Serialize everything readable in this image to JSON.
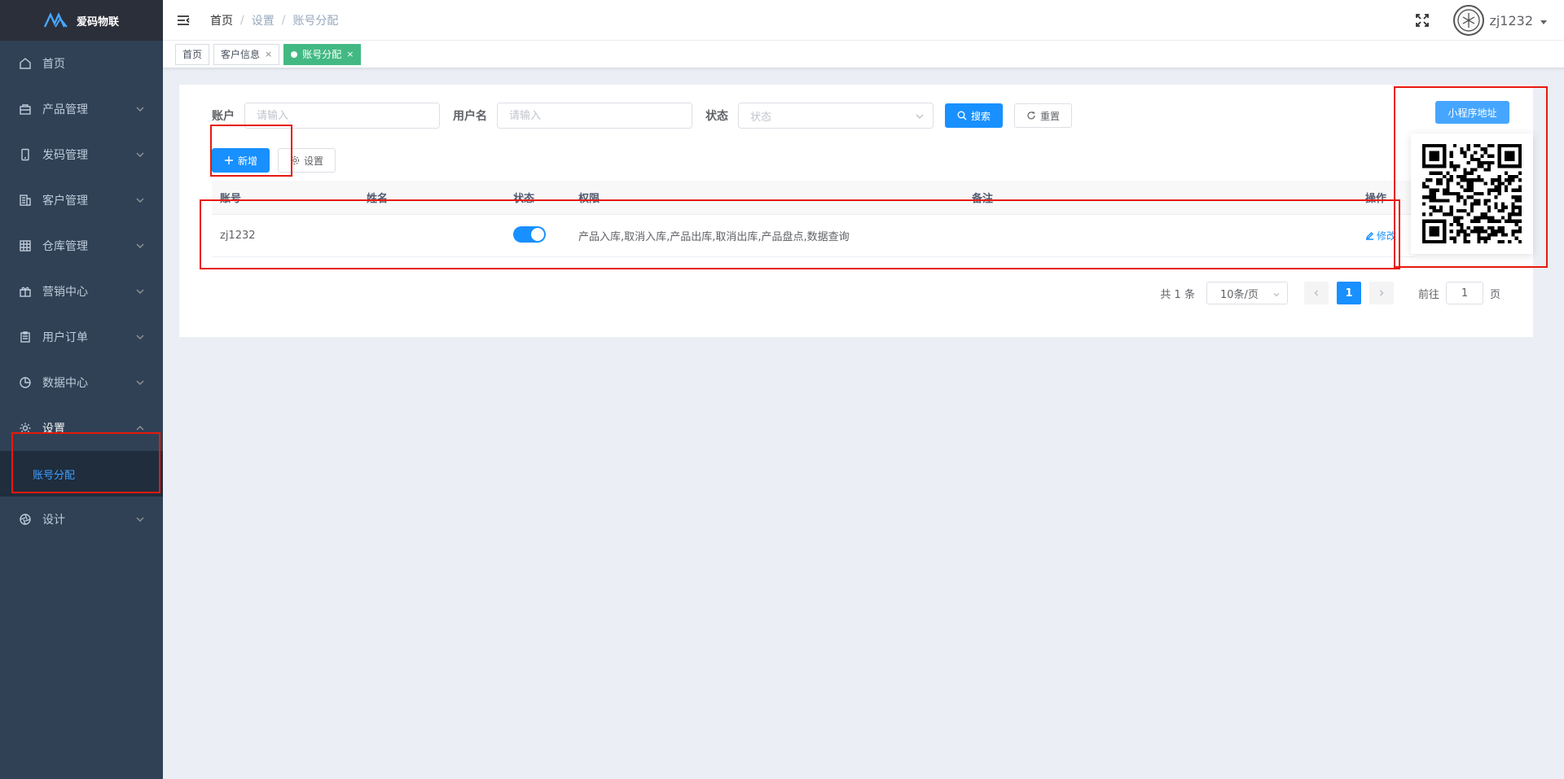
{
  "app": {
    "name": "爱码物联"
  },
  "sidebar": {
    "items": [
      {
        "label": "首页",
        "icon": "home-icon",
        "has_arrow": false
      },
      {
        "label": "产品管理",
        "icon": "bag-icon",
        "has_arrow": true
      },
      {
        "label": "发码管理",
        "icon": "phone-icon",
        "has_arrow": true
      },
      {
        "label": "客户管理",
        "icon": "building-icon",
        "has_arrow": true
      },
      {
        "label": "仓库管理",
        "icon": "grid-icon",
        "has_arrow": true
      },
      {
        "label": "营销中心",
        "icon": "gift-icon",
        "has_arrow": true
      },
      {
        "label": "用户订单",
        "icon": "clipboard-icon",
        "has_arrow": true
      },
      {
        "label": "数据中心",
        "icon": "pie-icon",
        "has_arrow": true
      },
      {
        "label": "设置",
        "icon": "gear-icon",
        "has_arrow": true,
        "expanded": true
      },
      {
        "label": "设计",
        "icon": "aperture-icon",
        "has_arrow": true
      }
    ],
    "submenu": {
      "label": "账号分配"
    }
  },
  "navbar": {
    "breadcrumb": [
      "首页",
      "设置",
      "账号分配"
    ],
    "username": "zj1232"
  },
  "tags": [
    {
      "label": "首页",
      "closable": false,
      "active": false
    },
    {
      "label": "客户信息",
      "closable": true,
      "active": false
    },
    {
      "label": "账号分配",
      "closable": true,
      "active": true
    }
  ],
  "tag_close": "×",
  "search": {
    "account_label": "账户",
    "account_placeholder": "请输入",
    "username_label": "用户名",
    "username_placeholder": "请输入",
    "status_label": "状态",
    "status_placeholder": "状态",
    "search_button": "搜索",
    "reset_button": "重置"
  },
  "toolbar": {
    "add_button": "新增",
    "settings_button": "设置"
  },
  "table": {
    "columns": [
      "账号",
      "姓名",
      "状态",
      "权限",
      "备注",
      "操作"
    ],
    "rows": [
      {
        "account": "zj1232",
        "name": "",
        "status_on": true,
        "permissions": "产品入库,取消入库,产品出库,取消出库,产品盘点,数据查询",
        "note": "",
        "action": "修改"
      }
    ]
  },
  "pagination": {
    "total": "共 1 条",
    "page_size": "10条/页",
    "current_page": "1",
    "goto_label": "前往",
    "goto_value": "1",
    "page_suffix": "页"
  },
  "mini_program": {
    "button": "小程序地址"
  },
  "colors": {
    "sidebar_bg": "#304156",
    "primary": "#1890ff",
    "tag_active": "#42b983",
    "annotation": "#e8190e"
  }
}
